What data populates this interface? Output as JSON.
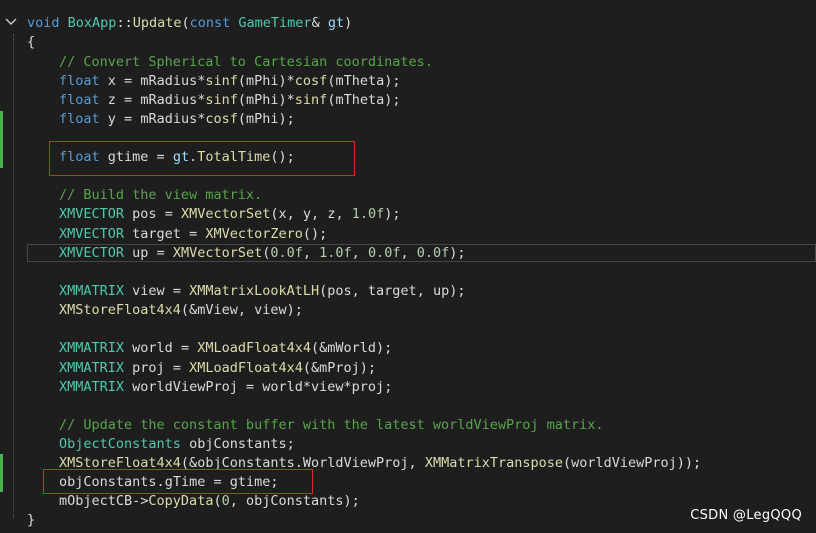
{
  "editor": {
    "fold_glyph": "⌄",
    "lines": [
      [
        [
          "k",
          "void"
        ],
        [
          "p",
          " "
        ],
        [
          "t",
          "BoxApp"
        ],
        [
          "p",
          "::"
        ],
        [
          "f",
          "Update"
        ],
        [
          "p",
          "("
        ],
        [
          "k",
          "const"
        ],
        [
          "p",
          " "
        ],
        [
          "t",
          "GameTimer"
        ],
        [
          "p",
          "& "
        ],
        [
          "v",
          "gt"
        ],
        [
          "p",
          ")"
        ]
      ],
      [
        [
          "p",
          "{"
        ]
      ],
      [
        [
          "c",
          "// Convert Spherical to Cartesian coordinates."
        ]
      ],
      [
        [
          "k",
          "float"
        ],
        [
          "p",
          " "
        ],
        [
          "m",
          "x"
        ],
        [
          "p",
          " = "
        ],
        [
          "m",
          "mRadius"
        ],
        [
          "p",
          "*"
        ],
        [
          "f",
          "sinf"
        ],
        [
          "p",
          "("
        ],
        [
          "m",
          "mPhi"
        ],
        [
          "p",
          ")*"
        ],
        [
          "f",
          "cosf"
        ],
        [
          "p",
          "("
        ],
        [
          "m",
          "mTheta"
        ],
        [
          "p",
          ");"
        ]
      ],
      [
        [
          "k",
          "float"
        ],
        [
          "p",
          " "
        ],
        [
          "m",
          "z"
        ],
        [
          "p",
          " = "
        ],
        [
          "m",
          "mRadius"
        ],
        [
          "p",
          "*"
        ],
        [
          "f",
          "sinf"
        ],
        [
          "p",
          "("
        ],
        [
          "m",
          "mPhi"
        ],
        [
          "p",
          ")*"
        ],
        [
          "f",
          "sinf"
        ],
        [
          "p",
          "("
        ],
        [
          "m",
          "mTheta"
        ],
        [
          "p",
          ");"
        ]
      ],
      [
        [
          "k",
          "float"
        ],
        [
          "p",
          " "
        ],
        [
          "m",
          "y"
        ],
        [
          "p",
          " = "
        ],
        [
          "m",
          "mRadius"
        ],
        [
          "p",
          "*"
        ],
        [
          "f",
          "cosf"
        ],
        [
          "p",
          "("
        ],
        [
          "m",
          "mPhi"
        ],
        [
          "p",
          ");"
        ]
      ],
      [],
      [
        [
          "k",
          "float"
        ],
        [
          "p",
          " "
        ],
        [
          "m",
          "gtime"
        ],
        [
          "p",
          " = "
        ],
        [
          "v",
          "gt"
        ],
        [
          "p",
          "."
        ],
        [
          "f",
          "TotalTime"
        ],
        [
          "p",
          "();"
        ]
      ],
      [],
      [
        [
          "c",
          "// Build the view matrix."
        ]
      ],
      [
        [
          "t",
          "XMVECTOR"
        ],
        [
          "p",
          " "
        ],
        [
          "m",
          "pos"
        ],
        [
          "p",
          " = "
        ],
        [
          "f",
          "XMVectorSet"
        ],
        [
          "p",
          "("
        ],
        [
          "m",
          "x"
        ],
        [
          "p",
          ", "
        ],
        [
          "m",
          "y"
        ],
        [
          "p",
          ", "
        ],
        [
          "m",
          "z"
        ],
        [
          "p",
          ", "
        ],
        [
          "n",
          "1.0f"
        ],
        [
          "p",
          ");"
        ]
      ],
      [
        [
          "t",
          "XMVECTOR"
        ],
        [
          "p",
          " "
        ],
        [
          "m",
          "target"
        ],
        [
          "p",
          " = "
        ],
        [
          "f",
          "XMVectorZero"
        ],
        [
          "p",
          "();"
        ]
      ],
      [
        [
          "t",
          "XMVECTOR"
        ],
        [
          "p",
          " "
        ],
        [
          "m",
          "up"
        ],
        [
          "p",
          " = "
        ],
        [
          "f",
          "XMVectorSet"
        ],
        [
          "p",
          "("
        ],
        [
          "n",
          "0.0f"
        ],
        [
          "p",
          ", "
        ],
        [
          "n",
          "1.0f"
        ],
        [
          "p",
          ", "
        ],
        [
          "n",
          "0.0f"
        ],
        [
          "p",
          ", "
        ],
        [
          "n",
          "0.0f"
        ],
        [
          "p",
          ");"
        ]
      ],
      [],
      [
        [
          "t",
          "XMMATRIX"
        ],
        [
          "p",
          " "
        ],
        [
          "m",
          "view"
        ],
        [
          "p",
          " = "
        ],
        [
          "f",
          "XMMatrixLookAtLH"
        ],
        [
          "p",
          "("
        ],
        [
          "m",
          "pos"
        ],
        [
          "p",
          ", "
        ],
        [
          "m",
          "target"
        ],
        [
          "p",
          ", "
        ],
        [
          "m",
          "up"
        ],
        [
          "p",
          ");"
        ]
      ],
      [
        [
          "f",
          "XMStoreFloat4x4"
        ],
        [
          "p",
          "(&"
        ],
        [
          "m",
          "mView"
        ],
        [
          "p",
          ", "
        ],
        [
          "m",
          "view"
        ],
        [
          "p",
          ");"
        ]
      ],
      [],
      [
        [
          "t",
          "XMMATRIX"
        ],
        [
          "p",
          " "
        ],
        [
          "m",
          "world"
        ],
        [
          "p",
          " = "
        ],
        [
          "f",
          "XMLoadFloat4x4"
        ],
        [
          "p",
          "(&"
        ],
        [
          "m",
          "mWorld"
        ],
        [
          "p",
          ");"
        ]
      ],
      [
        [
          "t",
          "XMMATRIX"
        ],
        [
          "p",
          " "
        ],
        [
          "m",
          "proj"
        ],
        [
          "p",
          " = "
        ],
        [
          "f",
          "XMLoadFloat4x4"
        ],
        [
          "p",
          "(&"
        ],
        [
          "m",
          "mProj"
        ],
        [
          "p",
          ");"
        ]
      ],
      [
        [
          "t",
          "XMMATRIX"
        ],
        [
          "p",
          " "
        ],
        [
          "m",
          "worldViewProj"
        ],
        [
          "p",
          " = "
        ],
        [
          "m",
          "world"
        ],
        [
          "p",
          "*"
        ],
        [
          "m",
          "view"
        ],
        [
          "p",
          "*"
        ],
        [
          "m",
          "proj"
        ],
        [
          "p",
          ";"
        ]
      ],
      [],
      [
        [
          "c",
          "// Update the constant buffer with the latest worldViewProj matrix."
        ]
      ],
      [
        [
          "t",
          "ObjectConstants"
        ],
        [
          "p",
          " "
        ],
        [
          "m",
          "objConstants"
        ],
        [
          "p",
          ";"
        ]
      ],
      [
        [
          "f",
          "XMStoreFloat4x4"
        ],
        [
          "p",
          "(&"
        ],
        [
          "m",
          "objConstants"
        ],
        [
          "p",
          "."
        ],
        [
          "m",
          "WorldViewProj"
        ],
        [
          "p",
          ", "
        ],
        [
          "f",
          "XMMatrixTranspose"
        ],
        [
          "p",
          "("
        ],
        [
          "m",
          "worldViewProj"
        ],
        [
          "p",
          "));"
        ]
      ],
      [
        [
          "m",
          "objConstants"
        ],
        [
          "p",
          "."
        ],
        [
          "m",
          "gTime"
        ],
        [
          "p",
          " = "
        ],
        [
          "m",
          "gtime"
        ],
        [
          "p",
          ";"
        ]
      ],
      [
        [
          "m",
          "mObjectCB"
        ],
        [
          "p",
          "->"
        ],
        [
          "f",
          "CopyData"
        ],
        [
          "p",
          "("
        ],
        [
          "n",
          "0"
        ],
        [
          "p",
          ", "
        ],
        [
          "m",
          "objConstants"
        ],
        [
          "p",
          ");"
        ]
      ],
      [
        [
          "p",
          "}"
        ]
      ]
    ]
  },
  "watermark": "CSDN @LegQQQ",
  "colors": {
    "background": "#1e1e1e",
    "keyword": "#569cd6",
    "type": "#4ec9b0",
    "function": "#dcdcaa",
    "comment": "#57a64a",
    "number": "#b5cea8",
    "change_marker": "#4caf50",
    "highlight_box": "#e0262b"
  }
}
